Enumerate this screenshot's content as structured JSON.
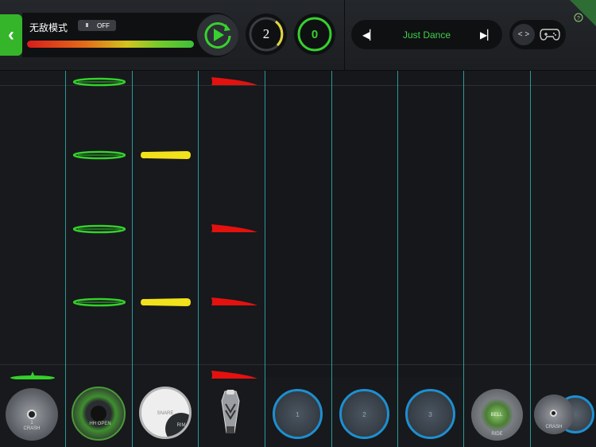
{
  "header": {
    "mode_title": "无敌模式",
    "toggle_bars": "III",
    "toggle_state": "OFF",
    "counter_one": "2",
    "counter_two": "0",
    "song_title": "Just Dance"
  },
  "pads": {
    "crash_left": "CRASH",
    "crash_left_num": "1",
    "hihat": "HH OPEN",
    "snare": "SNARE",
    "rim": "RIM",
    "tom1": "1",
    "tom2": "2",
    "tom3": "3",
    "ride": "RIDE",
    "ride_bell": "BELL",
    "crash_right": "CRASH"
  },
  "colors": {
    "accent_green": "#35b52a",
    "note_green": "#34d12b",
    "note_yellow": "#f2e21c",
    "note_red": "#e4110f",
    "lane_line": "#2bb3b0"
  }
}
